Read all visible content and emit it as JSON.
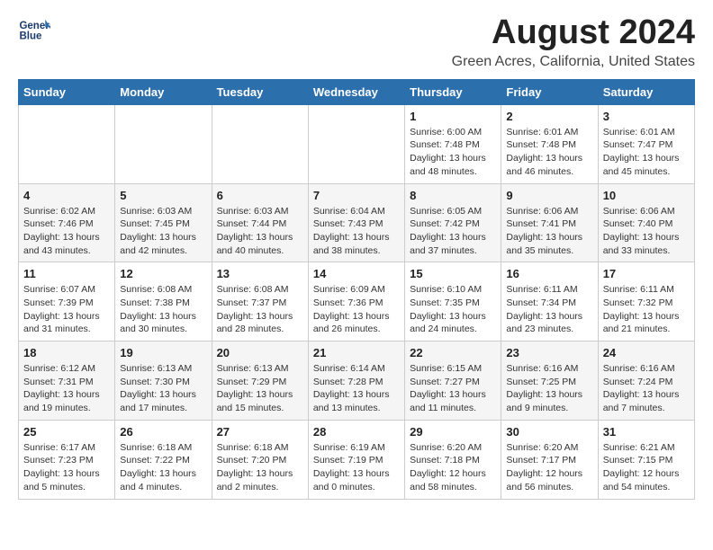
{
  "header": {
    "logo_line1": "General",
    "logo_line2": "Blue",
    "month_year": "August 2024",
    "location": "Green Acres, California, United States"
  },
  "calendar": {
    "days_of_week": [
      "Sunday",
      "Monday",
      "Tuesday",
      "Wednesday",
      "Thursday",
      "Friday",
      "Saturday"
    ],
    "weeks": [
      [
        {
          "day": "",
          "info": ""
        },
        {
          "day": "",
          "info": ""
        },
        {
          "day": "",
          "info": ""
        },
        {
          "day": "",
          "info": ""
        },
        {
          "day": "1",
          "info": "Sunrise: 6:00 AM\nSunset: 7:48 PM\nDaylight: 13 hours\nand 48 minutes."
        },
        {
          "day": "2",
          "info": "Sunrise: 6:01 AM\nSunset: 7:48 PM\nDaylight: 13 hours\nand 46 minutes."
        },
        {
          "day": "3",
          "info": "Sunrise: 6:01 AM\nSunset: 7:47 PM\nDaylight: 13 hours\nand 45 minutes."
        }
      ],
      [
        {
          "day": "4",
          "info": "Sunrise: 6:02 AM\nSunset: 7:46 PM\nDaylight: 13 hours\nand 43 minutes."
        },
        {
          "day": "5",
          "info": "Sunrise: 6:03 AM\nSunset: 7:45 PM\nDaylight: 13 hours\nand 42 minutes."
        },
        {
          "day": "6",
          "info": "Sunrise: 6:03 AM\nSunset: 7:44 PM\nDaylight: 13 hours\nand 40 minutes."
        },
        {
          "day": "7",
          "info": "Sunrise: 6:04 AM\nSunset: 7:43 PM\nDaylight: 13 hours\nand 38 minutes."
        },
        {
          "day": "8",
          "info": "Sunrise: 6:05 AM\nSunset: 7:42 PM\nDaylight: 13 hours\nand 37 minutes."
        },
        {
          "day": "9",
          "info": "Sunrise: 6:06 AM\nSunset: 7:41 PM\nDaylight: 13 hours\nand 35 minutes."
        },
        {
          "day": "10",
          "info": "Sunrise: 6:06 AM\nSunset: 7:40 PM\nDaylight: 13 hours\nand 33 minutes."
        }
      ],
      [
        {
          "day": "11",
          "info": "Sunrise: 6:07 AM\nSunset: 7:39 PM\nDaylight: 13 hours\nand 31 minutes."
        },
        {
          "day": "12",
          "info": "Sunrise: 6:08 AM\nSunset: 7:38 PM\nDaylight: 13 hours\nand 30 minutes."
        },
        {
          "day": "13",
          "info": "Sunrise: 6:08 AM\nSunset: 7:37 PM\nDaylight: 13 hours\nand 28 minutes."
        },
        {
          "day": "14",
          "info": "Sunrise: 6:09 AM\nSunset: 7:36 PM\nDaylight: 13 hours\nand 26 minutes."
        },
        {
          "day": "15",
          "info": "Sunrise: 6:10 AM\nSunset: 7:35 PM\nDaylight: 13 hours\nand 24 minutes."
        },
        {
          "day": "16",
          "info": "Sunrise: 6:11 AM\nSunset: 7:34 PM\nDaylight: 13 hours\nand 23 minutes."
        },
        {
          "day": "17",
          "info": "Sunrise: 6:11 AM\nSunset: 7:32 PM\nDaylight: 13 hours\nand 21 minutes."
        }
      ],
      [
        {
          "day": "18",
          "info": "Sunrise: 6:12 AM\nSunset: 7:31 PM\nDaylight: 13 hours\nand 19 minutes."
        },
        {
          "day": "19",
          "info": "Sunrise: 6:13 AM\nSunset: 7:30 PM\nDaylight: 13 hours\nand 17 minutes."
        },
        {
          "day": "20",
          "info": "Sunrise: 6:13 AM\nSunset: 7:29 PM\nDaylight: 13 hours\nand 15 minutes."
        },
        {
          "day": "21",
          "info": "Sunrise: 6:14 AM\nSunset: 7:28 PM\nDaylight: 13 hours\nand 13 minutes."
        },
        {
          "day": "22",
          "info": "Sunrise: 6:15 AM\nSunset: 7:27 PM\nDaylight: 13 hours\nand 11 minutes."
        },
        {
          "day": "23",
          "info": "Sunrise: 6:16 AM\nSunset: 7:25 PM\nDaylight: 13 hours\nand 9 minutes."
        },
        {
          "day": "24",
          "info": "Sunrise: 6:16 AM\nSunset: 7:24 PM\nDaylight: 13 hours\nand 7 minutes."
        }
      ],
      [
        {
          "day": "25",
          "info": "Sunrise: 6:17 AM\nSunset: 7:23 PM\nDaylight: 13 hours\nand 5 minutes."
        },
        {
          "day": "26",
          "info": "Sunrise: 6:18 AM\nSunset: 7:22 PM\nDaylight: 13 hours\nand 4 minutes."
        },
        {
          "day": "27",
          "info": "Sunrise: 6:18 AM\nSunset: 7:20 PM\nDaylight: 13 hours\nand 2 minutes."
        },
        {
          "day": "28",
          "info": "Sunrise: 6:19 AM\nSunset: 7:19 PM\nDaylight: 13 hours\nand 0 minutes."
        },
        {
          "day": "29",
          "info": "Sunrise: 6:20 AM\nSunset: 7:18 PM\nDaylight: 12 hours\nand 58 minutes."
        },
        {
          "day": "30",
          "info": "Sunrise: 6:20 AM\nSunset: 7:17 PM\nDaylight: 12 hours\nand 56 minutes."
        },
        {
          "day": "31",
          "info": "Sunrise: 6:21 AM\nSunset: 7:15 PM\nDaylight: 12 hours\nand 54 minutes."
        }
      ]
    ]
  }
}
